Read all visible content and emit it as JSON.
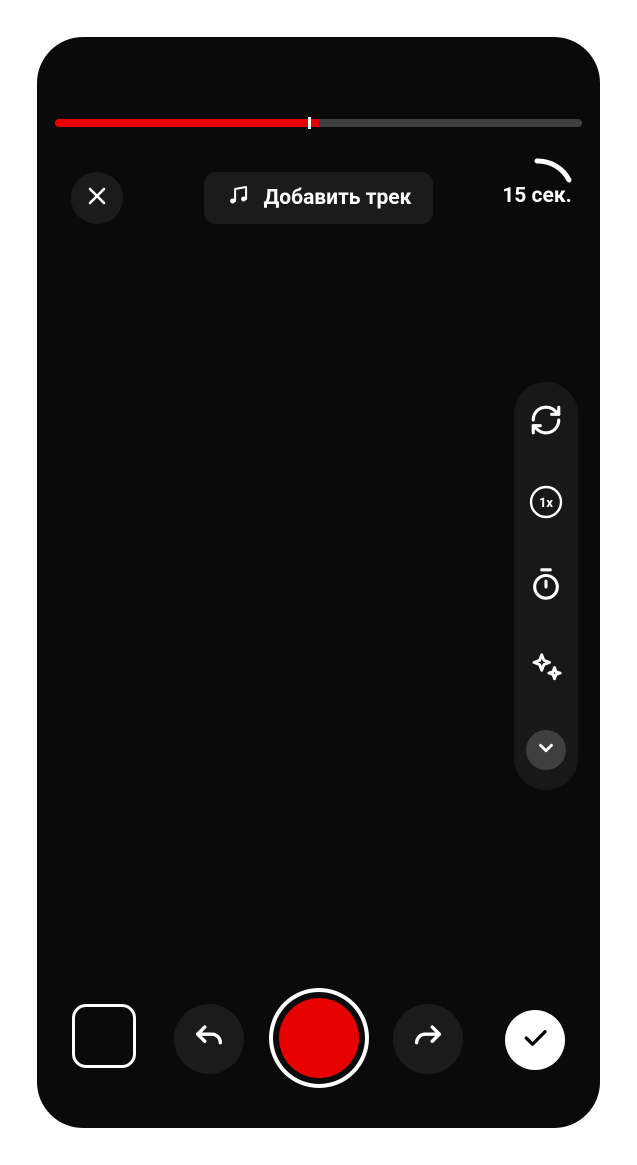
{
  "progress": {
    "percent": 50,
    "marker_percent": 48
  },
  "top": {
    "add_track_label": "Добавить трек",
    "duration_label": "15 сек."
  },
  "side_tools": {
    "speed_label": "1x"
  },
  "colors": {
    "accent": "#e80000"
  },
  "icons": {
    "close": "close-icon",
    "music": "music-note-icon",
    "flip": "flip-camera-icon",
    "speed": "speed-icon",
    "timer": "timer-icon",
    "effects": "sparkle-icon",
    "expand": "chevron-down-icon",
    "stop": "stop-icon",
    "undo": "undo-icon",
    "redo": "redo-icon",
    "record": "record-icon",
    "confirm": "check-icon"
  }
}
